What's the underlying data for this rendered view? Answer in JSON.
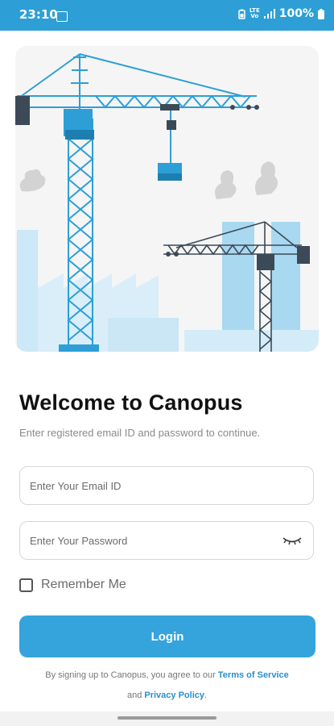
{
  "status_bar": {
    "time": "23:10",
    "battery": "100%",
    "network_top": "LTE",
    "network_bottom": "Vo",
    "icons": [
      "gallery-icon",
      "battery-saver-icon",
      "volte-icon",
      "signal-icon",
      "battery-icon"
    ]
  },
  "hero": {
    "illustration": "construction-cranes-illustration",
    "colors": {
      "primary": "#2d9fd6",
      "light": "#cbe6f5"
    }
  },
  "login": {
    "title": "Welcome to Canopus",
    "subtitle": "Enter registered email ID and password to continue.",
    "email_placeholder": "Enter Your Email ID",
    "email_value": "",
    "password_placeholder": "Enter Your Password",
    "password_value": "",
    "remember_label": "Remember Me",
    "remember_checked": false,
    "button_label": "Login"
  },
  "terms": {
    "prefix": "By signing up to Canopus, you agree to our",
    "terms_link": "Terms of Service",
    "and": "and",
    "privacy_link": "Privacy Policy",
    "suffix": "."
  },
  "theme": {
    "accent": "#35a4dc",
    "statusbar": "#2d9fd6",
    "link": "#2a8fcb"
  }
}
